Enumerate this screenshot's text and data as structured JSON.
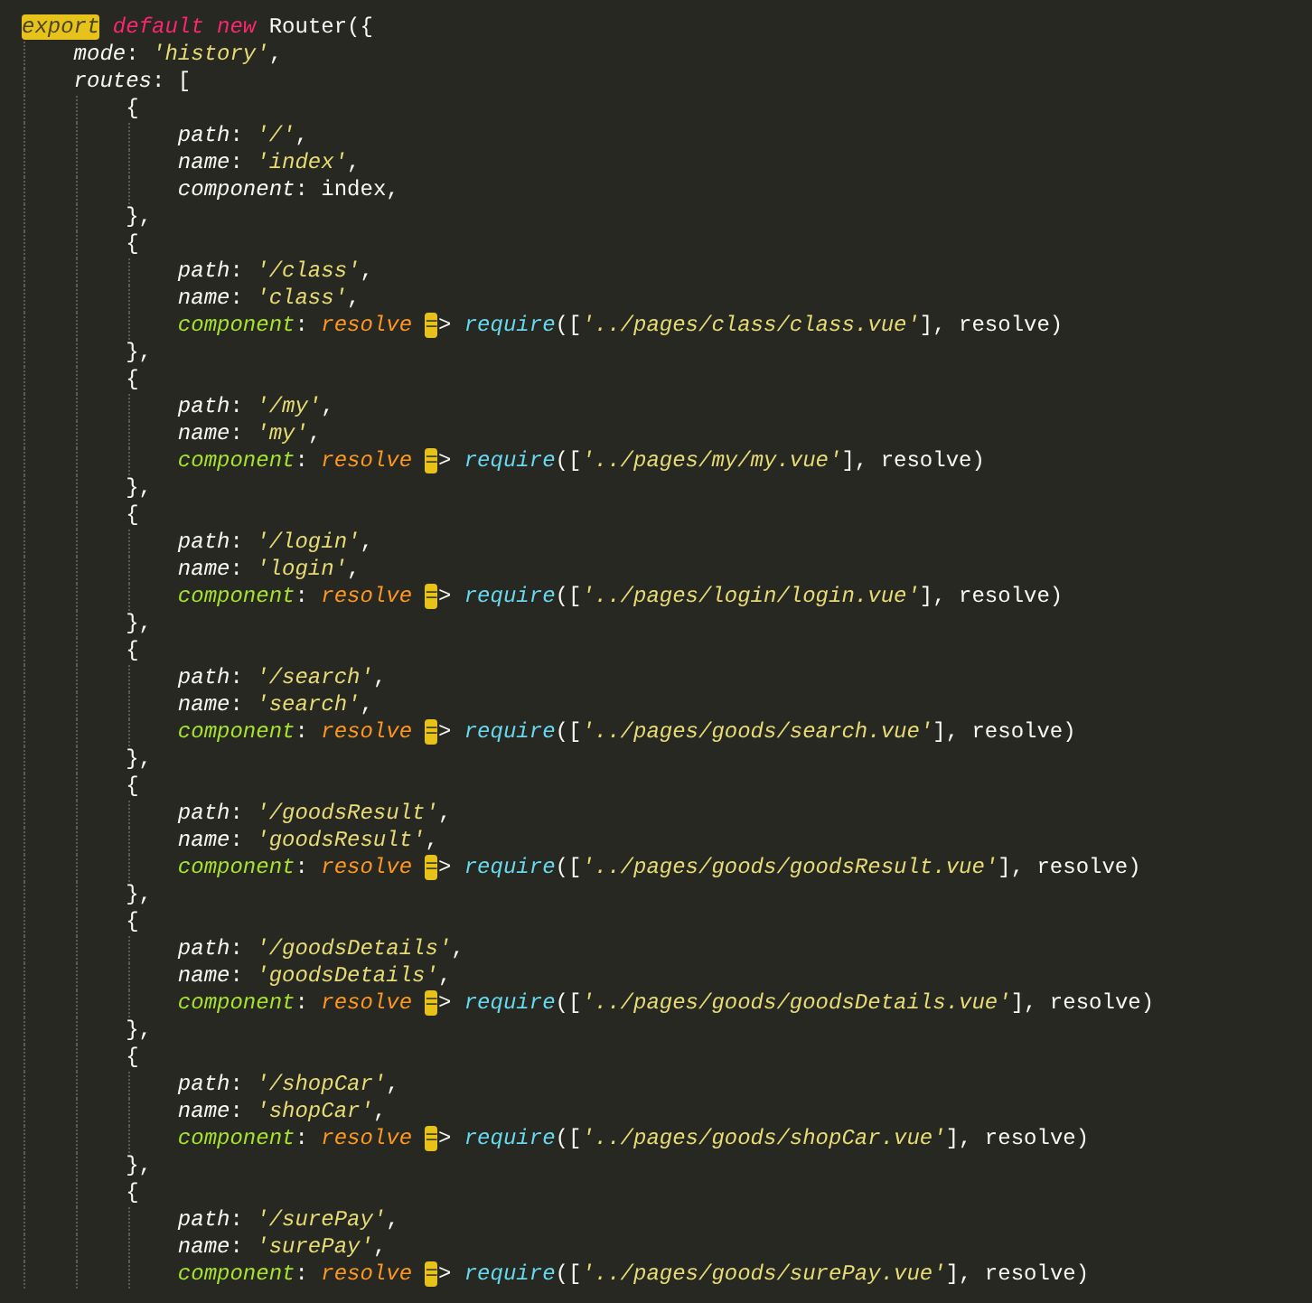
{
  "editor": {
    "lines": [
      {
        "tokens": [
          {
            "kind": "match",
            "text": "export"
          },
          {
            "kind": "keyword",
            "text": " default"
          },
          {
            "kind": "keyword",
            "text": " new"
          },
          {
            "kind": "plain",
            "text": " Router({"
          }
        ]
      },
      {
        "tokens": [
          {
            "kind": "prop",
            "text": "    mode"
          },
          {
            "kind": "plain",
            "text": ": "
          },
          {
            "kind": "string",
            "text": "'history'"
          },
          {
            "kind": "plain",
            "text": ","
          }
        ]
      },
      {
        "tokens": [
          {
            "kind": "prop",
            "text": "    routes"
          },
          {
            "kind": "plain",
            "text": ": ["
          }
        ]
      },
      {
        "tokens": [
          {
            "kind": "plain",
            "text": "        {"
          }
        ]
      },
      {
        "tokens": [
          {
            "kind": "prop",
            "text": "            path"
          },
          {
            "kind": "plain",
            "text": ": "
          },
          {
            "kind": "string",
            "text": "'/'"
          },
          {
            "kind": "plain",
            "text": ","
          }
        ]
      },
      {
        "tokens": [
          {
            "kind": "prop",
            "text": "            name"
          },
          {
            "kind": "plain",
            "text": ": "
          },
          {
            "kind": "string",
            "text": "'index'"
          },
          {
            "kind": "plain",
            "text": ","
          }
        ]
      },
      {
        "tokens": [
          {
            "kind": "prop",
            "text": "            component"
          },
          {
            "kind": "plain",
            "text": ": index,"
          }
        ]
      },
      {
        "tokens": [
          {
            "kind": "plain",
            "text": "        },"
          }
        ]
      },
      {
        "tokens": [
          {
            "kind": "plain",
            "text": "        {"
          }
        ]
      },
      {
        "tokens": [
          {
            "kind": "prop",
            "text": "            path"
          },
          {
            "kind": "plain",
            "text": ": "
          },
          {
            "kind": "string",
            "text": "'/class'"
          },
          {
            "kind": "plain",
            "text": ","
          }
        ]
      },
      {
        "tokens": [
          {
            "kind": "prop",
            "text": "            name"
          },
          {
            "kind": "plain",
            "text": ": "
          },
          {
            "kind": "string",
            "text": "'class'"
          },
          {
            "kind": "plain",
            "text": ","
          }
        ]
      },
      {
        "tokens": [
          {
            "kind": "func-prop",
            "text": "            component"
          },
          {
            "kind": "plain",
            "text": ": "
          },
          {
            "kind": "param",
            "text": "resolve "
          },
          {
            "kind": "match",
            "text": "="
          },
          {
            "kind": "plain",
            "text": "> "
          },
          {
            "kind": "call",
            "text": "require"
          },
          {
            "kind": "plain",
            "text": "(["
          },
          {
            "kind": "string",
            "text": "'../pages/class/class.vue'"
          },
          {
            "kind": "plain",
            "text": "], resolve)"
          }
        ]
      },
      {
        "tokens": [
          {
            "kind": "plain",
            "text": "        },"
          }
        ]
      },
      {
        "tokens": [
          {
            "kind": "plain",
            "text": "        {"
          }
        ]
      },
      {
        "tokens": [
          {
            "kind": "prop",
            "text": "            path"
          },
          {
            "kind": "plain",
            "text": ": "
          },
          {
            "kind": "string",
            "text": "'/my'"
          },
          {
            "kind": "plain",
            "text": ","
          }
        ]
      },
      {
        "tokens": [
          {
            "kind": "prop",
            "text": "            name"
          },
          {
            "kind": "plain",
            "text": ": "
          },
          {
            "kind": "string",
            "text": "'my'"
          },
          {
            "kind": "plain",
            "text": ","
          }
        ]
      },
      {
        "tokens": [
          {
            "kind": "func-prop",
            "text": "            component"
          },
          {
            "kind": "plain",
            "text": ": "
          },
          {
            "kind": "param",
            "text": "resolve "
          },
          {
            "kind": "match",
            "text": "="
          },
          {
            "kind": "plain",
            "text": "> "
          },
          {
            "kind": "call",
            "text": "require"
          },
          {
            "kind": "plain",
            "text": "(["
          },
          {
            "kind": "string",
            "text": "'../pages/my/my.vue'"
          },
          {
            "kind": "plain",
            "text": "], resolve)"
          }
        ]
      },
      {
        "tokens": [
          {
            "kind": "plain",
            "text": "        },"
          }
        ]
      },
      {
        "tokens": [
          {
            "kind": "plain",
            "text": "        {"
          }
        ]
      },
      {
        "tokens": [
          {
            "kind": "prop",
            "text": "            path"
          },
          {
            "kind": "plain",
            "text": ": "
          },
          {
            "kind": "string",
            "text": "'/login'"
          },
          {
            "kind": "plain",
            "text": ","
          }
        ]
      },
      {
        "tokens": [
          {
            "kind": "prop",
            "text": "            name"
          },
          {
            "kind": "plain",
            "text": ": "
          },
          {
            "kind": "string",
            "text": "'login'"
          },
          {
            "kind": "plain",
            "text": ","
          }
        ]
      },
      {
        "tokens": [
          {
            "kind": "func-prop",
            "text": "            component"
          },
          {
            "kind": "plain",
            "text": ": "
          },
          {
            "kind": "param",
            "text": "resolve "
          },
          {
            "kind": "match",
            "text": "="
          },
          {
            "kind": "plain",
            "text": "> "
          },
          {
            "kind": "call",
            "text": "require"
          },
          {
            "kind": "plain",
            "text": "(["
          },
          {
            "kind": "string",
            "text": "'../pages/login/login.vue'"
          },
          {
            "kind": "plain",
            "text": "], resolve)"
          }
        ]
      },
      {
        "tokens": [
          {
            "kind": "plain",
            "text": "        },"
          }
        ]
      },
      {
        "tokens": [
          {
            "kind": "plain",
            "text": "        {"
          }
        ]
      },
      {
        "tokens": [
          {
            "kind": "prop",
            "text": "            path"
          },
          {
            "kind": "plain",
            "text": ": "
          },
          {
            "kind": "string",
            "text": "'/search'"
          },
          {
            "kind": "plain",
            "text": ","
          }
        ]
      },
      {
        "tokens": [
          {
            "kind": "prop",
            "text": "            name"
          },
          {
            "kind": "plain",
            "text": ": "
          },
          {
            "kind": "string",
            "text": "'search'"
          },
          {
            "kind": "plain",
            "text": ","
          }
        ]
      },
      {
        "tokens": [
          {
            "kind": "func-prop",
            "text": "            component"
          },
          {
            "kind": "plain",
            "text": ": "
          },
          {
            "kind": "param",
            "text": "resolve "
          },
          {
            "kind": "match",
            "text": "="
          },
          {
            "kind": "plain",
            "text": "> "
          },
          {
            "kind": "call",
            "text": "require"
          },
          {
            "kind": "plain",
            "text": "(["
          },
          {
            "kind": "string",
            "text": "'../pages/goods/search.vue'"
          },
          {
            "kind": "plain",
            "text": "], resolve)"
          }
        ]
      },
      {
        "tokens": [
          {
            "kind": "plain",
            "text": "        },"
          }
        ]
      },
      {
        "tokens": [
          {
            "kind": "plain",
            "text": "        {"
          }
        ]
      },
      {
        "tokens": [
          {
            "kind": "prop",
            "text": "            path"
          },
          {
            "kind": "plain",
            "text": ": "
          },
          {
            "kind": "string",
            "text": "'/goodsResult'"
          },
          {
            "kind": "plain",
            "text": ","
          }
        ]
      },
      {
        "tokens": [
          {
            "kind": "prop",
            "text": "            name"
          },
          {
            "kind": "plain",
            "text": ": "
          },
          {
            "kind": "string",
            "text": "'goodsResult'"
          },
          {
            "kind": "plain",
            "text": ","
          }
        ]
      },
      {
        "tokens": [
          {
            "kind": "func-prop",
            "text": "            component"
          },
          {
            "kind": "plain",
            "text": ": "
          },
          {
            "kind": "param",
            "text": "resolve "
          },
          {
            "kind": "match",
            "text": "="
          },
          {
            "kind": "plain",
            "text": "> "
          },
          {
            "kind": "call",
            "text": "require"
          },
          {
            "kind": "plain",
            "text": "(["
          },
          {
            "kind": "string",
            "text": "'../pages/goods/goodsResult.vue'"
          },
          {
            "kind": "plain",
            "text": "], resolve)"
          }
        ]
      },
      {
        "tokens": [
          {
            "kind": "plain",
            "text": "        },"
          }
        ]
      },
      {
        "tokens": [
          {
            "kind": "plain",
            "text": "        {"
          }
        ]
      },
      {
        "tokens": [
          {
            "kind": "prop",
            "text": "            path"
          },
          {
            "kind": "plain",
            "text": ": "
          },
          {
            "kind": "string",
            "text": "'/goodsDetails'"
          },
          {
            "kind": "plain",
            "text": ","
          }
        ]
      },
      {
        "tokens": [
          {
            "kind": "prop",
            "text": "            name"
          },
          {
            "kind": "plain",
            "text": ": "
          },
          {
            "kind": "string",
            "text": "'goodsDetails'"
          },
          {
            "kind": "plain",
            "text": ","
          }
        ]
      },
      {
        "tokens": [
          {
            "kind": "func-prop",
            "text": "            component"
          },
          {
            "kind": "plain",
            "text": ": "
          },
          {
            "kind": "param",
            "text": "resolve "
          },
          {
            "kind": "match",
            "text": "="
          },
          {
            "kind": "plain",
            "text": "> "
          },
          {
            "kind": "call",
            "text": "require"
          },
          {
            "kind": "plain",
            "text": "(["
          },
          {
            "kind": "string",
            "text": "'../pages/goods/goodsDetails.vue'"
          },
          {
            "kind": "plain",
            "text": "], resolve)"
          }
        ]
      },
      {
        "tokens": [
          {
            "kind": "plain",
            "text": "        },"
          }
        ]
      },
      {
        "tokens": [
          {
            "kind": "plain",
            "text": "        {"
          }
        ]
      },
      {
        "tokens": [
          {
            "kind": "prop",
            "text": "            path"
          },
          {
            "kind": "plain",
            "text": ": "
          },
          {
            "kind": "string",
            "text": "'/shopCar'"
          },
          {
            "kind": "plain",
            "text": ","
          }
        ]
      },
      {
        "tokens": [
          {
            "kind": "prop",
            "text": "            name"
          },
          {
            "kind": "plain",
            "text": ": "
          },
          {
            "kind": "string",
            "text": "'shopCar'"
          },
          {
            "kind": "plain",
            "text": ","
          }
        ]
      },
      {
        "tokens": [
          {
            "kind": "func-prop",
            "text": "            component"
          },
          {
            "kind": "plain",
            "text": ": "
          },
          {
            "kind": "param",
            "text": "resolve "
          },
          {
            "kind": "match",
            "text": "="
          },
          {
            "kind": "plain",
            "text": "> "
          },
          {
            "kind": "call",
            "text": "require"
          },
          {
            "kind": "plain",
            "text": "(["
          },
          {
            "kind": "string",
            "text": "'../pages/goods/shopCar.vue'"
          },
          {
            "kind": "plain",
            "text": "], resolve)"
          }
        ]
      },
      {
        "tokens": [
          {
            "kind": "plain",
            "text": "        },"
          }
        ]
      },
      {
        "tokens": [
          {
            "kind": "plain",
            "text": "        {"
          }
        ]
      },
      {
        "tokens": [
          {
            "kind": "prop",
            "text": "            path"
          },
          {
            "kind": "plain",
            "text": ": "
          },
          {
            "kind": "string",
            "text": "'/surePay'"
          },
          {
            "kind": "plain",
            "text": ","
          }
        ]
      },
      {
        "tokens": [
          {
            "kind": "prop",
            "text": "            name"
          },
          {
            "kind": "plain",
            "text": ": "
          },
          {
            "kind": "string",
            "text": "'surePay'"
          },
          {
            "kind": "plain",
            "text": ","
          }
        ]
      },
      {
        "tokens": [
          {
            "kind": "func-prop",
            "text": "            component"
          },
          {
            "kind": "plain",
            "text": ": "
          },
          {
            "kind": "param",
            "text": "resolve "
          },
          {
            "kind": "match",
            "text": "="
          },
          {
            "kind": "plain",
            "text": "> "
          },
          {
            "kind": "call",
            "text": "require"
          },
          {
            "kind": "plain",
            "text": "(["
          },
          {
            "kind": "string",
            "text": "'../pages/goods/surePay.vue'"
          },
          {
            "kind": "plain",
            "text": "], resolve)"
          }
        ]
      }
    ]
  }
}
